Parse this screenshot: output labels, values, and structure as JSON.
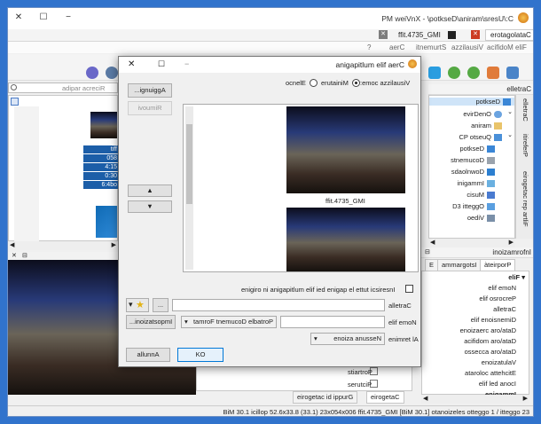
{
  "window": {
    "title": "C:\\Users\\marina\\Desktop\\ - XnView MP"
  },
  "tabs": [
    {
      "label": "Catalogatore"
    },
    {
      "label": "IMG_5374.tiff"
    }
  ],
  "menu": [
    "File",
    "Modifica",
    "Visualizza",
    "Strumenti",
    "Crea",
    "?"
  ],
  "search": {
    "placeholder": "Ricerca rapida"
  },
  "folders_panel": {
    "title": "Cartelle",
    "items": [
      {
        "label": "Desktop",
        "icon": "desktop-icon"
      },
      {
        "label": "OneDrive",
        "icon": "cloud-icon"
      },
      {
        "label": "marina",
        "icon": "user-folder-icon"
      },
      {
        "label": "Questo PC",
        "icon": "computer-icon"
      },
      {
        "label": "Desktop",
        "icon": "desktop-icon"
      },
      {
        "label": "Documents",
        "icon": "document-icon"
      },
      {
        "label": "Downloads",
        "icon": "download-icon"
      },
      {
        "label": "Immagini",
        "icon": "picture-icon"
      },
      {
        "label": "Music",
        "icon": "music-icon"
      },
      {
        "label": "Oggetti 3D",
        "icon": "cube-icon"
      },
      {
        "label": "Video",
        "icon": "video-icon"
      }
    ],
    "side_tabs": [
      "Cartelle",
      "Preferiti",
      "Filtra per categorie"
    ]
  },
  "info_panel": {
    "title": "Informazioni",
    "tabs": [
      "Proprietà",
      "Istogramma",
      "E"
    ],
    "section": "File",
    "fields": [
      "Nome file",
      "Percorso file",
      "Cartella",
      "Dimensione file",
      "Data/ora creazione",
      "Data/ora modifica",
      "Data/ora accesso",
      "Valutazione",
      "Etichetta colorata",
      "Icona del file",
      "Immagine"
    ]
  },
  "categories_panel": {
    "items": [
      "Portraits",
      "Pictures"
    ],
    "tabs": [
      "Categorie",
      "Gruppi di categorie"
    ]
  },
  "thumb_tags": [
    "tiff",
    "058",
    "4:15",
    "0:30",
    "6:4bo"
  ],
  "status_bar": "32 oggetti / 1 oggetto selezionato [1.03 MiB]   IMG_5374.tiff   600x450x32 (1.33)   8.33x6.25 pollici   1.03 MiB",
  "dialog": {
    "title": "Crea file multipagina",
    "add_button": "Aggiungi...",
    "remove_button": "Rimuovi",
    "view_label": "Visualizza come:",
    "view_options": [
      "Miniature",
      "Elenco"
    ],
    "view_selected": "Miniature",
    "thumb_caption": "IMG_5374.tiff",
    "insert_all_checkbox": "Inserisci tutte le pagine dei file multipagina in origine",
    "folder_label": "Cartella",
    "folder_value": "",
    "browse_button": "...",
    "filename_label": "Nome file",
    "filename_value": "",
    "format_value": "Portable Document Format",
    "settings_button": "Impostazioni...",
    "at_end_label": "Al termine",
    "at_end_value": "Nessuna azione",
    "ok_button": "OK",
    "cancel_button": "Annulla"
  }
}
